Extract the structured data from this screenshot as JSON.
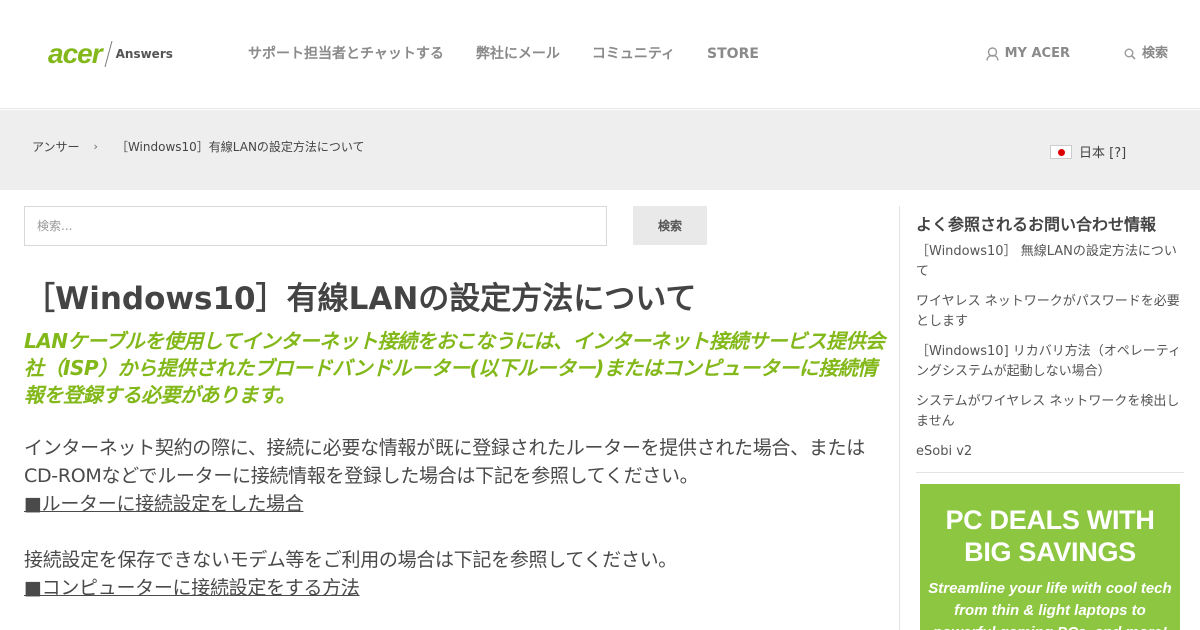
{
  "header": {
    "logo_brand": "acer",
    "logo_product": "Answers",
    "nav": [
      {
        "label": "サポート担当者とチャットする"
      },
      {
        "label": "弊社にメール"
      },
      {
        "label": "コミュニティ"
      },
      {
        "label": "STORE"
      }
    ],
    "my_acer_label": "MY ACER",
    "my_acer_icon": "user-icon",
    "search_label": "検索",
    "search_icon": "search-icon"
  },
  "breadcrumb": {
    "items": [
      "アンサー",
      "［Windows10］有線LANの設定方法について"
    ],
    "separator": "›"
  },
  "language": {
    "label": "日本 [?]",
    "flag_icon": "japan-flag-icon"
  },
  "search": {
    "placeholder": "検索...",
    "button_label": "検索"
  },
  "article": {
    "title": "［Windows10］有線LANの設定方法について",
    "lead": "LANケーブルを使用してインターネット接続をおこなうには、インターネット接続サービス提供会社（ISP）から提供されたブロードバンドルーター(以下ルーター)またはコンピューターに接続情報を登録する必要があります。",
    "para1": "インターネット契約の際に、接続に必要な情報が既に登録されたルーターを提供された場合、またはCD-ROMなどでルーターに接続情報を登録した場合は下記を参照してください。",
    "link1": "■ルーターに接続設定をした場合",
    "para2": "接続設定を保存できないモデム等をご利用の場合は下記を参照してください。",
    "link2": "■コンピューターに接続設定をする方法"
  },
  "sidebar": {
    "title": "よく参照されるお問い合わせ情報",
    "links": [
      {
        "label": "［Windows10］ 無線LANの設定方法について"
      },
      {
        "label": "ワイヤレス ネットワークがパスワードを必要とします"
      },
      {
        "label": "［Windows10] リカバリ方法（オペレーティングシステムが起動しない場合）"
      },
      {
        "label": "システムがワイヤレス ネットワークを検出しません"
      },
      {
        "label": "eSobi v2"
      }
    ]
  },
  "promo": {
    "headline_line1": "PC DEALS WITH",
    "headline_line2": "BIG SAVINGS",
    "sub_line1": "Streamline your life with cool tech",
    "sub_line2": "from thin & light laptops to",
    "sub_line3": "powerful gaming PCs, and more!"
  },
  "colors": {
    "brand_green": "#83b81a",
    "promo_green": "#8dc641",
    "breadcrumb_bg": "#eeeeee"
  }
}
